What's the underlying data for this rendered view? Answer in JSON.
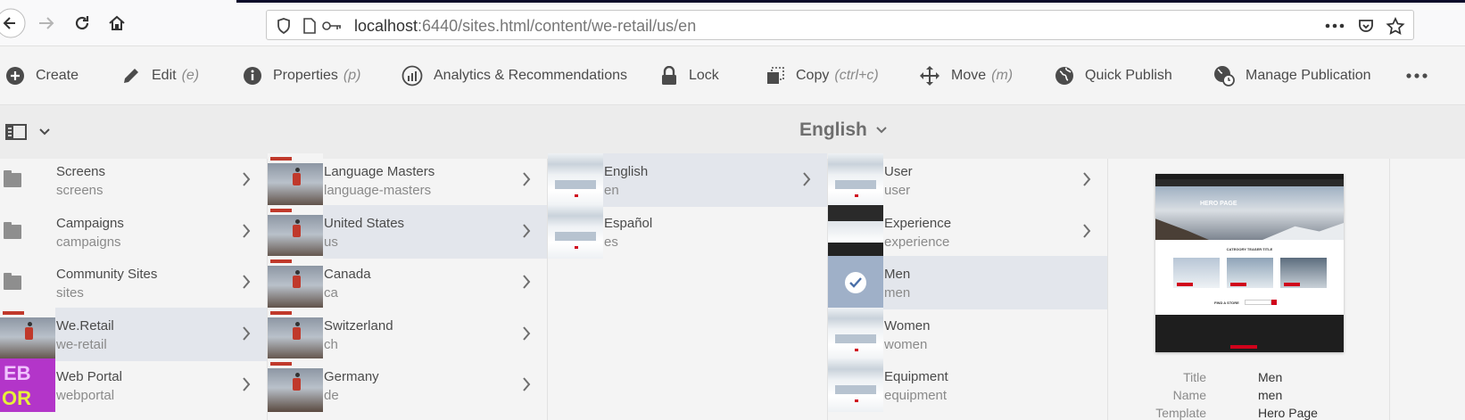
{
  "browser": {
    "url_host": "localhost",
    "url_rest": ":6440/sites.html/content/we-retail/us/en"
  },
  "actions": [
    {
      "id": "create",
      "label": "Create",
      "shortcut": "",
      "icon": "plus-circle-icon"
    },
    {
      "id": "edit",
      "label": "Edit",
      "shortcut": "(e)",
      "icon": "pencil-icon"
    },
    {
      "id": "properties",
      "label": "Properties",
      "shortcut": "(p)",
      "icon": "info-icon"
    },
    {
      "id": "analytics",
      "label": "Analytics & Recommendations",
      "shortcut": "",
      "icon": "analytics-icon"
    },
    {
      "id": "lock",
      "label": "Lock",
      "shortcut": "",
      "icon": "lock-icon"
    },
    {
      "id": "copy",
      "label": "Copy",
      "shortcut": "(ctrl+c)",
      "icon": "copy-icon"
    },
    {
      "id": "move",
      "label": "Move",
      "shortcut": "(m)",
      "icon": "move-icon"
    },
    {
      "id": "quick_publish",
      "label": "Quick Publish",
      "shortcut": "",
      "icon": "globe-icon"
    },
    {
      "id": "manage_publication",
      "label": "Manage Publication",
      "shortcut": "",
      "icon": "globe-clock-icon"
    },
    {
      "id": "more",
      "label": "",
      "shortcut": "",
      "icon": "more-icon"
    }
  ],
  "sub_header": {
    "title": "English"
  },
  "columns": [
    {
      "items": [
        {
          "title": "Screens",
          "name": "screens",
          "thumb": "folder",
          "selected": false
        },
        {
          "title": "Campaigns",
          "name": "campaigns",
          "thumb": "folder",
          "selected": false
        },
        {
          "title": "Community Sites",
          "name": "sites",
          "thumb": "folder",
          "selected": false
        },
        {
          "title": "We.Retail",
          "name": "we-retail",
          "thumb": "climber",
          "selected": true
        },
        {
          "title": "Web Portal",
          "name": "webportal",
          "thumb": "webportal",
          "selected": false
        }
      ]
    },
    {
      "items": [
        {
          "title": "Language Masters",
          "name": "language-masters",
          "thumb": "climber",
          "selected": false
        },
        {
          "title": "United States",
          "name": "us",
          "thumb": "climber",
          "selected": true
        },
        {
          "title": "Canada",
          "name": "ca",
          "thumb": "climber",
          "selected": false
        },
        {
          "title": "Switzerland",
          "name": "ch",
          "thumb": "climber",
          "selected": false
        },
        {
          "title": "Germany",
          "name": "de",
          "thumb": "climber",
          "selected": false
        }
      ]
    },
    {
      "items": [
        {
          "title": "English",
          "name": "en",
          "thumb": "page",
          "selected": true
        },
        {
          "title": "Español",
          "name": "es",
          "thumb": "page",
          "selected": false
        }
      ]
    },
    {
      "items": [
        {
          "title": "User",
          "name": "user",
          "thumb": "page",
          "selected": false
        },
        {
          "title": "Experience",
          "name": "experience",
          "thumb": "dark",
          "selected": false
        },
        {
          "title": "Men",
          "name": "men",
          "thumb": "checked",
          "selected": true
        },
        {
          "title": "Women",
          "name": "women",
          "thumb": "page",
          "selected": false
        },
        {
          "title": "Equipment",
          "name": "equipment",
          "thumb": "page",
          "selected": false
        }
      ]
    }
  ],
  "preview": {
    "hero_text": "HERO PAGE",
    "teaser_text": "CATEGORY TEASER TITLE",
    "store_text": "FIND A STORE",
    "meta": [
      {
        "key": "Title",
        "value": "Men"
      },
      {
        "key": "Name",
        "value": "men"
      },
      {
        "key": "Template",
        "value": "Hero Page"
      }
    ]
  },
  "colors": {
    "accent_highlight": "#f5f014",
    "selected_row": "#e3e6ec",
    "brand_red": "#d0021b"
  }
}
